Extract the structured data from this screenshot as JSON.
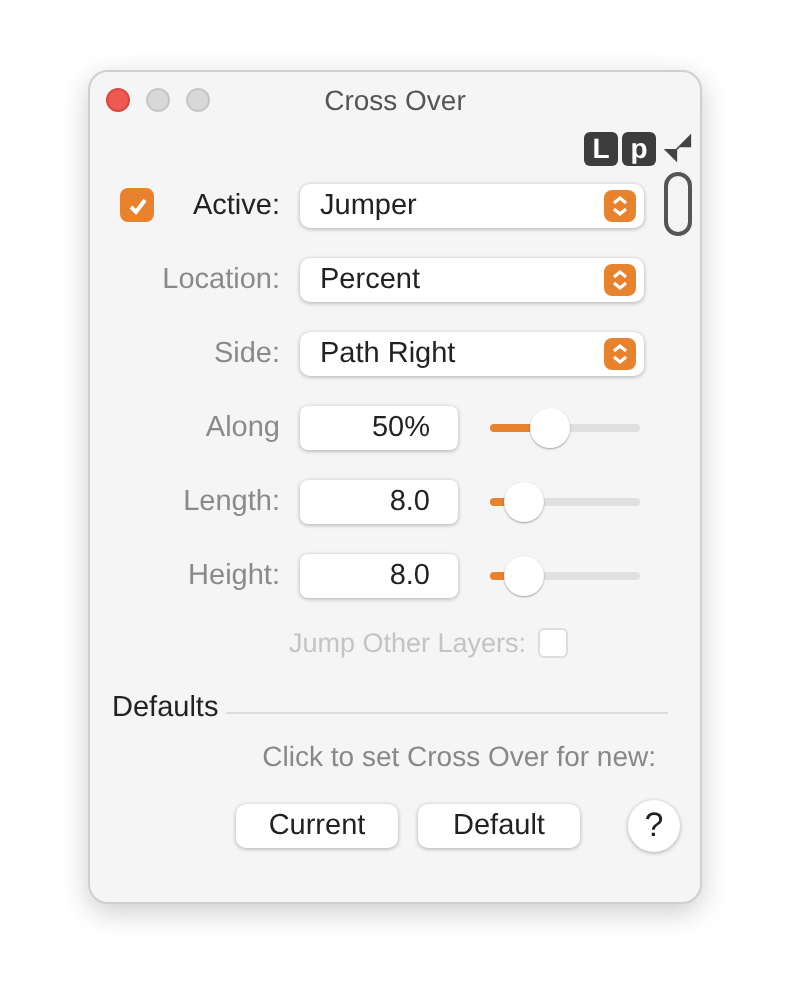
{
  "window": {
    "title": "Cross Over"
  },
  "badges": [
    "L",
    "p"
  ],
  "active": {
    "label": "Active:",
    "checked": true
  },
  "popups": [
    {
      "value": "Jumper",
      "kind": "checkbox"
    },
    {
      "label": "Location:",
      "value": "Percent",
      "kind": "plain"
    },
    {
      "label": "Side:",
      "value": "Path Right",
      "kind": "plain"
    }
  ],
  "sliders": [
    {
      "label": "Along",
      "value": "50%",
      "level": 0.35
    },
    {
      "label": "Length:",
      "value": "8.0",
      "level": 0.2
    },
    {
      "label": "Height:",
      "value": "8.0",
      "level": 0.2
    }
  ],
  "jump": {
    "label": "Jump Other Layers:",
    "checked": false,
    "disabled": true
  },
  "defaults": {
    "heading": "Defaults",
    "hint": "Click to set Cross Over for new:",
    "buttons": [
      "Current",
      "Default"
    ],
    "help": "?"
  }
}
